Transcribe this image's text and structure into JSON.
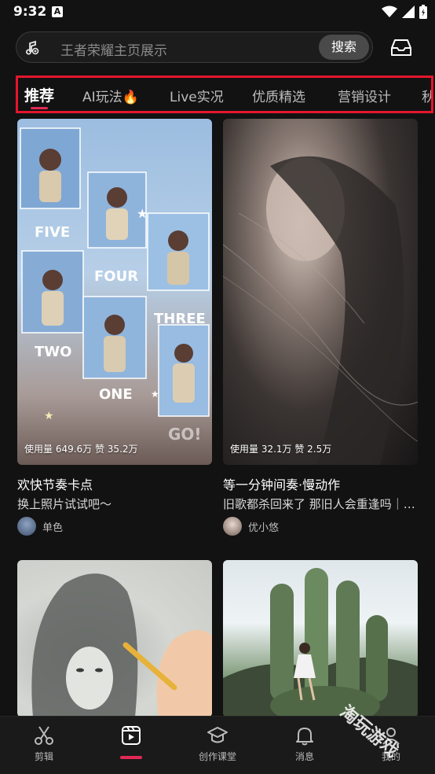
{
  "status": {
    "time": "9:32",
    "badge": "A"
  },
  "search": {
    "placeholder": "王者荣耀主页展示",
    "button": "搜索"
  },
  "tabs": [
    {
      "label": "推荐",
      "active": true
    },
    {
      "label": "AI玩法🔥",
      "active": false
    },
    {
      "label": "Live实况",
      "active": false
    },
    {
      "label": "优质精选",
      "active": false
    },
    {
      "label": "营销设计",
      "active": false
    },
    {
      "label": "秋",
      "active": false
    }
  ],
  "templates": [
    {
      "stats": "使用量 649.6万 赞 35.2万",
      "title": "欢快节奏卡点",
      "subtitle": "换上照片试试吧～",
      "author": "单色",
      "overlay": [
        "FIVE",
        "FOUR",
        "THREE",
        "TWO",
        "ONE",
        "GO!"
      ]
    },
    {
      "stats": "使用量 32.1万 赞 2.5万",
      "title": "等一分钟间奏·慢动作",
      "subtitle": "旧歌都杀回来了 那旧人会重逢吗｜b...",
      "author": "优小悠"
    },
    {
      "title": ""
    },
    {
      "title": ""
    }
  ],
  "nav": [
    {
      "label": "剪辑",
      "icon": "scissors-icon"
    },
    {
      "label": "",
      "icon": "template-icon",
      "active": true
    },
    {
      "label": "创作课堂",
      "icon": "graduation-cap-icon"
    },
    {
      "label": "消息",
      "icon": "bell-icon"
    },
    {
      "label": "我的",
      "icon": "person-icon"
    }
  ],
  "watermark": "淘玩游戏",
  "colors": {
    "accent": "#e32855",
    "highlight_border": "#e3162d",
    "background": "#121212"
  }
}
